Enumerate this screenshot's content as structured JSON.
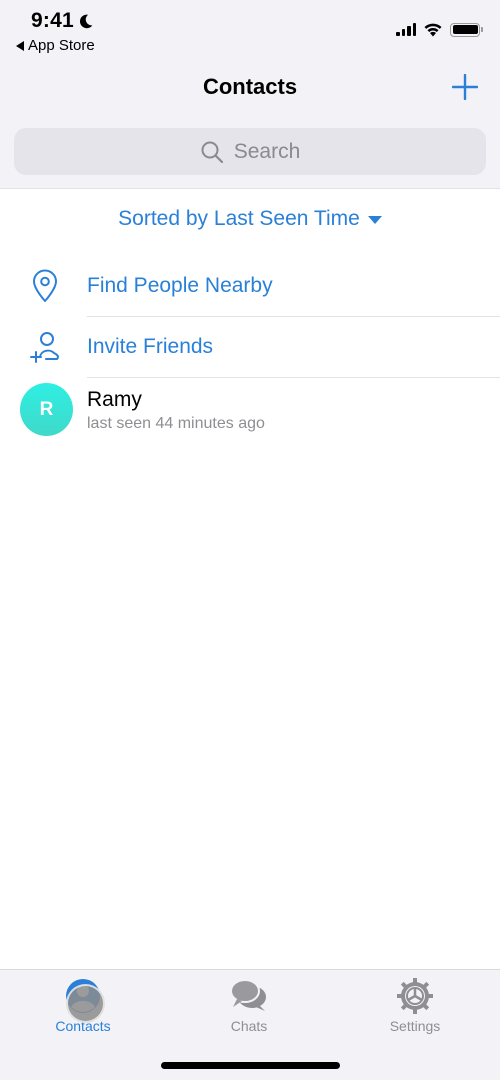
{
  "status_bar": {
    "time": "9:41",
    "back_app_label": "App Store",
    "icons": [
      "moon-icon",
      "signal-icon",
      "wifi-icon",
      "battery-icon"
    ]
  },
  "header": {
    "title": "Contacts",
    "add_icon": "plus-icon"
  },
  "search": {
    "placeholder": "Search",
    "icon": "search-icon"
  },
  "sort": {
    "label": "Sorted by Last Seen Time",
    "icon": "caret-down-icon"
  },
  "actions": [
    {
      "label": "Find People Nearby",
      "icon": "location-pin-icon"
    },
    {
      "label": "Invite Friends",
      "icon": "add-person-icon"
    }
  ],
  "contacts": [
    {
      "initial": "R",
      "name": "Ramy",
      "status": "last seen 44 minutes ago"
    }
  ],
  "tabbar": {
    "tabs": [
      {
        "label": "Contacts",
        "icon": "person-circle-icon",
        "active": true
      },
      {
        "label": "Chats",
        "icon": "chat-bubbles-icon",
        "active": false
      },
      {
        "label": "Settings",
        "icon": "gear-icon",
        "active": false
      }
    ]
  },
  "colors": {
    "accent": "#2a80d8",
    "header_bg": "#f3f2f7",
    "avatar_gradient_top": "#2eefe3",
    "avatar_gradient_bottom": "#3fd9c9",
    "secondary_text": "#8e8e93"
  }
}
